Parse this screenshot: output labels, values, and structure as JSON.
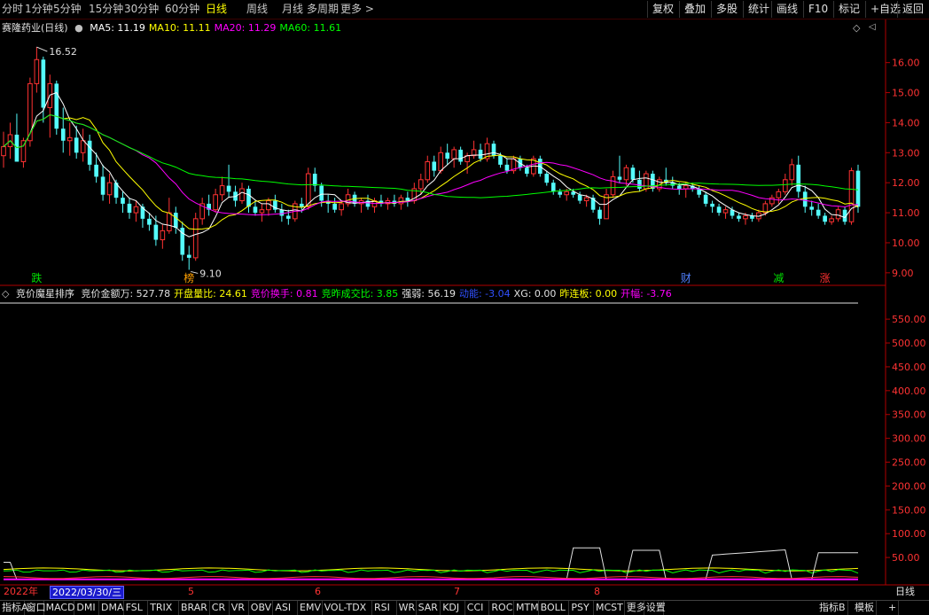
{
  "toolbar": {
    "periods": [
      "分时",
      "1分钟",
      "5分钟",
      "15分钟",
      "30分钟",
      "60分钟",
      "日线",
      "周线",
      "月线",
      "多周期",
      "更多 >"
    ],
    "active_period": "日线",
    "right_buttons": [
      "复权",
      "叠加",
      "多股",
      "统计",
      "画线",
      "F10",
      "标记",
      "+自选",
      "返回"
    ]
  },
  "main_chart": {
    "stock_title": "赛隆药业(日线)",
    "ma": [
      {
        "label": "MA5: 11.19",
        "color": "#ffffff"
      },
      {
        "label": "MA10: 11.11",
        "color": "#ffff00"
      },
      {
        "label": "MA20: 11.29",
        "color": "#ff00ff"
      },
      {
        "label": "MA60: 11.61",
        "color": "#00ff00"
      }
    ],
    "high_label": "16.52",
    "low_label": "9.10",
    "markers": [
      {
        "text": "跌",
        "color": "#00e000"
      },
      {
        "text": "榜",
        "color": "#ffa000"
      },
      {
        "text": "财",
        "color": "#5080ff"
      },
      {
        "text": "减",
        "color": "#00e000"
      },
      {
        "text": "涨",
        "color": "#ff3030"
      }
    ]
  },
  "indicator": {
    "name": "竞价魔星排序",
    "values": [
      {
        "label": "竞价金额万: 527.78",
        "color": "#e0e0e0"
      },
      {
        "label": "开盘量比: 24.61",
        "color": "#ffff00"
      },
      {
        "label": "竞价换手: 0.81",
        "color": "#ff00ff"
      },
      {
        "label": "竞昨成交比: 3.85",
        "color": "#00ff00"
      },
      {
        "label": "强弱: 56.19",
        "color": "#e0e0e0"
      },
      {
        "label": "动能: -3.04",
        "color": "#3050ff"
      },
      {
        "label": "XG: 0.00",
        "color": "#e0e0e0"
      },
      {
        "label": "昨连板: 0.00",
        "color": "#ffff00"
      },
      {
        "label": "开幅: -3.76",
        "color": "#ff00ff"
      }
    ]
  },
  "date_axis": {
    "year": "2022年",
    "cursor_date": "2022/03/30/三",
    "months": [
      "5",
      "6",
      "7",
      "8"
    ],
    "right_label": "日线"
  },
  "bottom_tabs": [
    "指标A",
    "窗口",
    "MACD",
    "DMI",
    "DMA",
    "FSL",
    "TRIX",
    "BRAR",
    "CR",
    "VR",
    "OBV",
    "ASI",
    "EMV",
    "VOL-TDX",
    "RSI",
    "WR",
    "SAR",
    "KDJ",
    "CCI",
    "ROC",
    "MTM",
    "BOLL",
    "PSY",
    "MCST",
    "更多",
    "设置"
  ],
  "bottom_right": [
    "指标B",
    "模板",
    "+"
  ],
  "chart_data": [
    {
      "type": "candlestick",
      "title": "赛隆药业(日线)",
      "yticks": [
        9.0,
        10.0,
        11.0,
        12.0,
        13.0,
        14.0,
        15.0,
        16.0
      ],
      "ylim": [
        8.7,
        17.2
      ],
      "grid": false,
      "candles": [
        [
          12.9,
          13.7,
          12.5,
          13.2
        ],
        [
          13.2,
          14.0,
          12.8,
          13.6
        ],
        [
          13.6,
          14.3,
          13.1,
          12.7
        ],
        [
          12.7,
          13.5,
          12.5,
          13.4
        ],
        [
          13.4,
          15.5,
          13.2,
          15.3
        ],
        [
          15.3,
          16.52,
          15.0,
          16.1
        ],
        [
          16.1,
          16.2,
          14.0,
          14.5
        ],
        [
          14.5,
          15.6,
          13.5,
          15.3
        ],
        [
          15.3,
          15.4,
          13.6,
          13.8
        ],
        [
          13.8,
          14.5,
          13.0,
          13.4
        ],
        [
          13.4,
          14.0,
          12.9,
          13.5
        ],
        [
          13.5,
          13.9,
          12.8,
          13.0
        ],
        [
          13.0,
          13.8,
          12.7,
          13.4
        ],
        [
          13.4,
          13.6,
          12.4,
          12.6
        ],
        [
          12.6,
          13.0,
          12.0,
          12.2
        ],
        [
          12.2,
          12.6,
          11.4,
          11.6
        ],
        [
          11.6,
          12.3,
          11.3,
          12.0
        ],
        [
          12.0,
          12.1,
          11.3,
          11.5
        ],
        [
          11.5,
          11.7,
          11.0,
          11.3
        ],
        [
          11.3,
          11.5,
          10.8,
          11.0
        ],
        [
          11.0,
          11.4,
          10.7,
          11.2
        ],
        [
          11.2,
          11.3,
          10.5,
          10.8
        ],
        [
          10.8,
          11.0,
          10.4,
          10.6
        ],
        [
          10.6,
          10.9,
          9.9,
          10.1
        ],
        [
          10.1,
          10.6,
          9.8,
          10.4
        ],
        [
          10.4,
          11.5,
          10.3,
          11.0
        ],
        [
          11.0,
          11.2,
          10.3,
          10.5
        ],
        [
          10.5,
          10.7,
          9.4,
          9.6
        ],
        [
          9.6,
          9.9,
          9.1,
          9.5
        ],
        [
          9.5,
          11.0,
          9.4,
          10.8
        ],
        [
          10.8,
          11.5,
          10.6,
          11.3
        ],
        [
          11.3,
          11.6,
          10.9,
          11.1
        ],
        [
          11.1,
          11.8,
          11.0,
          11.6
        ],
        [
          11.6,
          12.2,
          11.4,
          11.9
        ],
        [
          11.9,
          12.6,
          11.5,
          11.7
        ],
        [
          11.7,
          11.9,
          11.2,
          11.4
        ],
        [
          11.4,
          12.0,
          11.3,
          11.8
        ],
        [
          11.8,
          11.9,
          11.0,
          11.2
        ],
        [
          11.2,
          11.4,
          10.9,
          11.0
        ],
        [
          11.0,
          11.3,
          10.7,
          11.1
        ],
        [
          11.1,
          11.5,
          10.9,
          11.4
        ],
        [
          11.4,
          11.6,
          11.0,
          11.1
        ],
        [
          11.1,
          11.3,
          10.7,
          10.9
        ],
        [
          10.9,
          11.1,
          10.6,
          10.8
        ],
        [
          10.8,
          11.4,
          10.7,
          11.3
        ],
        [
          11.3,
          11.5,
          11.0,
          11.2
        ],
        [
          11.2,
          12.5,
          11.1,
          12.3
        ],
        [
          12.3,
          12.5,
          11.7,
          11.9
        ],
        [
          11.9,
          12.0,
          11.2,
          11.4
        ],
        [
          11.4,
          11.6,
          11.0,
          11.3
        ],
        [
          11.3,
          11.5,
          11.0,
          11.1
        ],
        [
          11.1,
          11.4,
          10.9,
          11.3
        ],
        [
          11.3,
          11.8,
          11.2,
          11.6
        ],
        [
          11.6,
          11.7,
          11.2,
          11.3
        ],
        [
          11.3,
          11.5,
          11.0,
          11.4
        ],
        [
          11.4,
          11.6,
          11.1,
          11.2
        ],
        [
          11.2,
          11.5,
          11.0,
          11.4
        ],
        [
          11.4,
          11.6,
          11.2,
          11.3
        ],
        [
          11.3,
          11.5,
          11.1,
          11.4
        ],
        [
          11.4,
          11.6,
          11.2,
          11.3
        ],
        [
          11.3,
          11.6,
          11.1,
          11.5
        ],
        [
          11.5,
          11.7,
          11.2,
          11.4
        ],
        [
          11.4,
          12.0,
          11.3,
          11.8
        ],
        [
          11.8,
          12.3,
          11.6,
          12.1
        ],
        [
          12.1,
          12.9,
          12.0,
          12.7
        ],
        [
          12.7,
          12.9,
          12.2,
          12.4
        ],
        [
          12.4,
          13.2,
          12.3,
          13.0
        ],
        [
          13.0,
          13.3,
          12.6,
          12.8
        ],
        [
          12.8,
          13.2,
          12.5,
          13.1
        ],
        [
          13.1,
          13.2,
          12.6,
          12.7
        ],
        [
          12.7,
          13.0,
          12.3,
          12.9
        ],
        [
          12.9,
          13.4,
          12.8,
          13.1
        ],
        [
          13.1,
          13.3,
          12.7,
          12.8
        ],
        [
          12.8,
          13.5,
          12.7,
          13.3
        ],
        [
          13.3,
          13.4,
          12.8,
          12.9
        ],
        [
          12.9,
          13.0,
          12.5,
          12.6
        ],
        [
          12.6,
          12.8,
          12.3,
          12.4
        ],
        [
          12.4,
          12.9,
          12.3,
          12.8
        ],
        [
          12.8,
          12.9,
          12.4,
          12.5
        ],
        [
          12.5,
          12.6,
          12.2,
          12.3
        ],
        [
          12.3,
          12.9,
          12.2,
          12.8
        ],
        [
          12.8,
          12.9,
          12.2,
          12.3
        ],
        [
          12.3,
          12.4,
          11.9,
          12.0
        ],
        [
          12.0,
          12.1,
          11.6,
          11.7
        ],
        [
          11.7,
          11.8,
          11.5,
          11.6
        ],
        [
          11.6,
          11.8,
          11.4,
          11.7
        ],
        [
          11.7,
          11.8,
          11.5,
          11.6
        ],
        [
          11.6,
          11.7,
          11.3,
          11.4
        ],
        [
          11.4,
          11.6,
          11.2,
          11.5
        ],
        [
          11.5,
          11.6,
          11.0,
          11.1
        ],
        [
          11.1,
          11.2,
          10.6,
          10.8
        ],
        [
          10.8,
          11.8,
          10.8,
          11.6
        ],
        [
          11.6,
          12.4,
          11.5,
          12.2
        ],
        [
          12.2,
          12.9,
          12.0,
          12.1
        ],
        [
          12.1,
          12.6,
          11.9,
          12.5
        ],
        [
          12.5,
          12.6,
          12.0,
          12.1
        ],
        [
          12.1,
          12.4,
          11.7,
          11.8
        ],
        [
          11.8,
          12.4,
          11.7,
          12.3
        ],
        [
          12.3,
          12.4,
          11.7,
          11.8
        ],
        [
          11.8,
          12.2,
          11.7,
          12.1
        ],
        [
          12.1,
          12.5,
          11.9,
          12.0
        ],
        [
          12.0,
          12.2,
          11.8,
          11.9
        ],
        [
          11.9,
          12.0,
          11.6,
          11.8
        ],
        [
          11.8,
          12.0,
          11.5,
          11.9
        ],
        [
          11.9,
          12.0,
          11.7,
          11.8
        ],
        [
          11.8,
          11.9,
          11.5,
          11.6
        ],
        [
          11.6,
          11.7,
          11.2,
          11.3
        ],
        [
          11.3,
          11.4,
          11.0,
          11.2
        ],
        [
          11.2,
          11.3,
          10.9,
          11.0
        ],
        [
          11.0,
          11.2,
          10.8,
          11.1
        ],
        [
          11.1,
          11.2,
          10.8,
          10.9
        ],
        [
          10.9,
          11.0,
          10.7,
          10.8
        ],
        [
          10.8,
          11.0,
          10.6,
          10.9
        ],
        [
          10.9,
          11.0,
          10.7,
          10.8
        ],
        [
          10.8,
          11.1,
          10.7,
          11.0
        ],
        [
          11.0,
          11.4,
          10.9,
          11.3
        ],
        [
          11.3,
          11.6,
          11.2,
          11.5
        ],
        [
          11.5,
          11.8,
          11.3,
          11.7
        ],
        [
          11.7,
          12.3,
          11.6,
          12.1
        ],
        [
          12.1,
          12.8,
          11.9,
          12.6
        ],
        [
          12.6,
          12.9,
          11.5,
          11.7
        ],
        [
          11.7,
          11.9,
          11.0,
          11.2
        ],
        [
          11.2,
          11.4,
          10.9,
          11.1
        ],
        [
          11.1,
          11.3,
          10.8,
          10.9
        ],
        [
          10.9,
          11.0,
          10.6,
          10.7
        ],
        [
          10.7,
          10.9,
          10.6,
          10.8
        ],
        [
          10.8,
          11.2,
          10.7,
          11.1
        ],
        [
          11.1,
          11.2,
          10.6,
          10.7
        ],
        [
          10.7,
          12.5,
          10.6,
          12.4
        ],
        [
          12.4,
          12.6,
          11.0,
          11.2
        ]
      ]
    },
    {
      "type": "line",
      "title": "竞价魔星排序",
      "yticks": [
        50.0,
        100.0,
        150.0,
        200.0,
        250.0,
        300.0,
        350.0,
        400.0,
        450.0,
        500.0,
        550.0
      ],
      "ylim": [
        0,
        580
      ],
      "grid": false
    }
  ]
}
